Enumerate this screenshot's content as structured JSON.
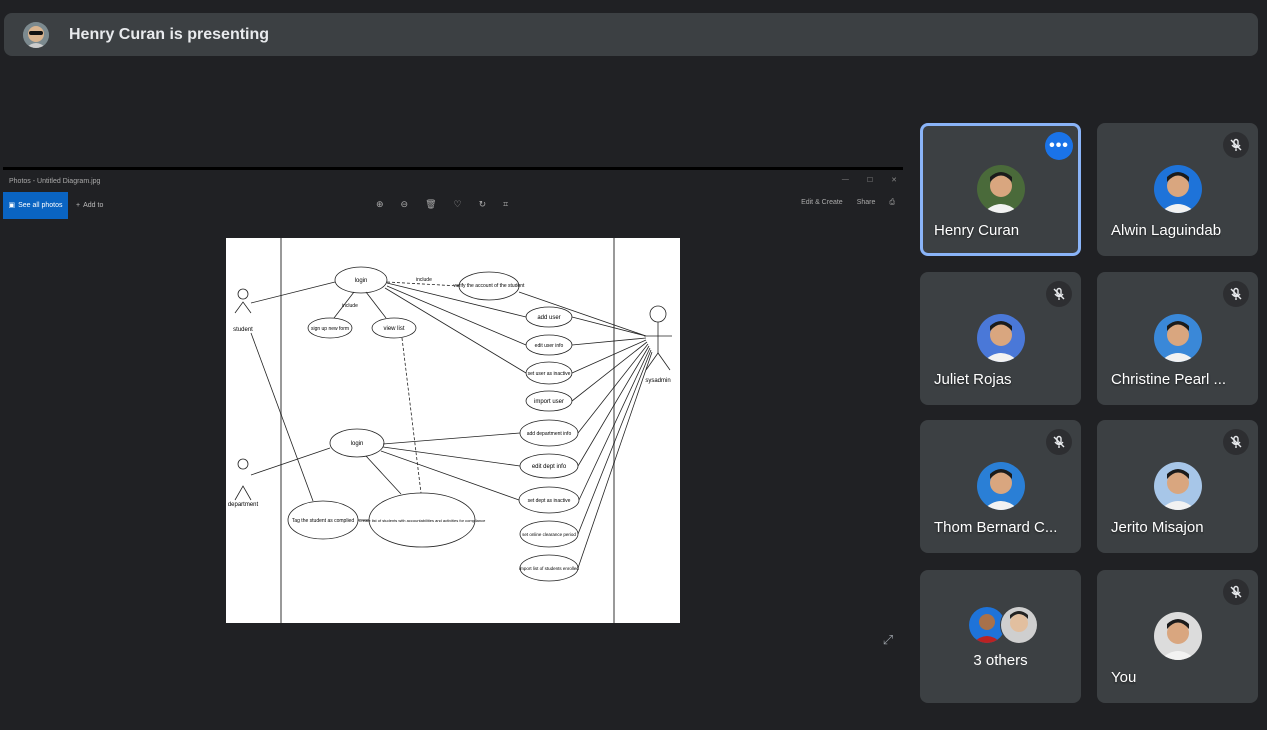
{
  "header": {
    "presenting_text": "Henry Curan is presenting",
    "avatar_icon": "presenter-avatar"
  },
  "shared_screen": {
    "window_title": "Photos - Untitled Diagram.jpg",
    "see_all_label": "See all photos",
    "add_to_label": "Add to",
    "edit_create_label": "Edit & Create",
    "share_label": "Share",
    "diagram": {
      "actor_student": "student",
      "actor_department": "department",
      "actor_sysadmin": "sysadmin",
      "uc_login1": "login",
      "uc_signup": "sign up new form",
      "uc_view_list": "view list",
      "uc_verify": "verify the account of the student",
      "uc_add_user": "add user",
      "uc_edit_user": "edit user info",
      "uc_set_inactive": "set user as inactive",
      "uc_import_user": "import user",
      "uc_add_dept": "add department info",
      "uc_edit_dept": "edit dept info",
      "uc_set_dept_inactive": "set dept as inactive",
      "uc_set_online": "set online clearance period",
      "uc_import_list": "import list of students enrolled",
      "uc_login2": "login",
      "uc_tag": "Tag the student as complied",
      "uc_create": "Create list of students with accountabilities and activities for compliance",
      "rel_include1": "include",
      "rel_include2": "include"
    }
  },
  "participants": [
    {
      "name": "Henry Curan",
      "active": true,
      "badge": "more-options-icon",
      "color": "#4a6a3a"
    },
    {
      "name": "Alwin Laguindab",
      "badge": "mic-off-icon",
      "color": "#1e73d9"
    },
    {
      "name": "Juliet Rojas",
      "badge": "mic-off-icon",
      "color": "#4a78d8"
    },
    {
      "name": "Christine Pearl ...",
      "badge": "mic-off-icon",
      "color": "#3a88d8"
    },
    {
      "name": "Thom Bernard C...",
      "badge": "mic-off-icon",
      "color": "#2a7fd6"
    },
    {
      "name": "Jerito Misajon",
      "badge": "mic-off-icon",
      "color": "#a7c6e8"
    },
    {
      "name": "3 others",
      "badge": "",
      "color": "#1e73d9"
    },
    {
      "name": "You",
      "badge": "mic-off-icon",
      "color": "#dcdcdc"
    }
  ],
  "colors": {
    "background": "#202124",
    "tile": "#3c4043",
    "active_border": "#8ab4f8",
    "accent": "#1a73e8"
  }
}
